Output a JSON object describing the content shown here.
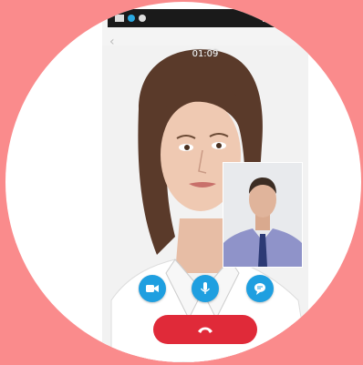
{
  "call": {
    "caller_name": "",
    "timer": "01:09"
  },
  "controls": {
    "video_icon": "video-camera-icon",
    "mic_icon": "microphone-icon",
    "chat_icon": "chat-bubble-icon",
    "end_icon": "phone-hangup-icon"
  },
  "colors": {
    "background": "#fa8b8c",
    "control_blue": "#1f9fe0",
    "end_call_red": "#e02a39"
  }
}
